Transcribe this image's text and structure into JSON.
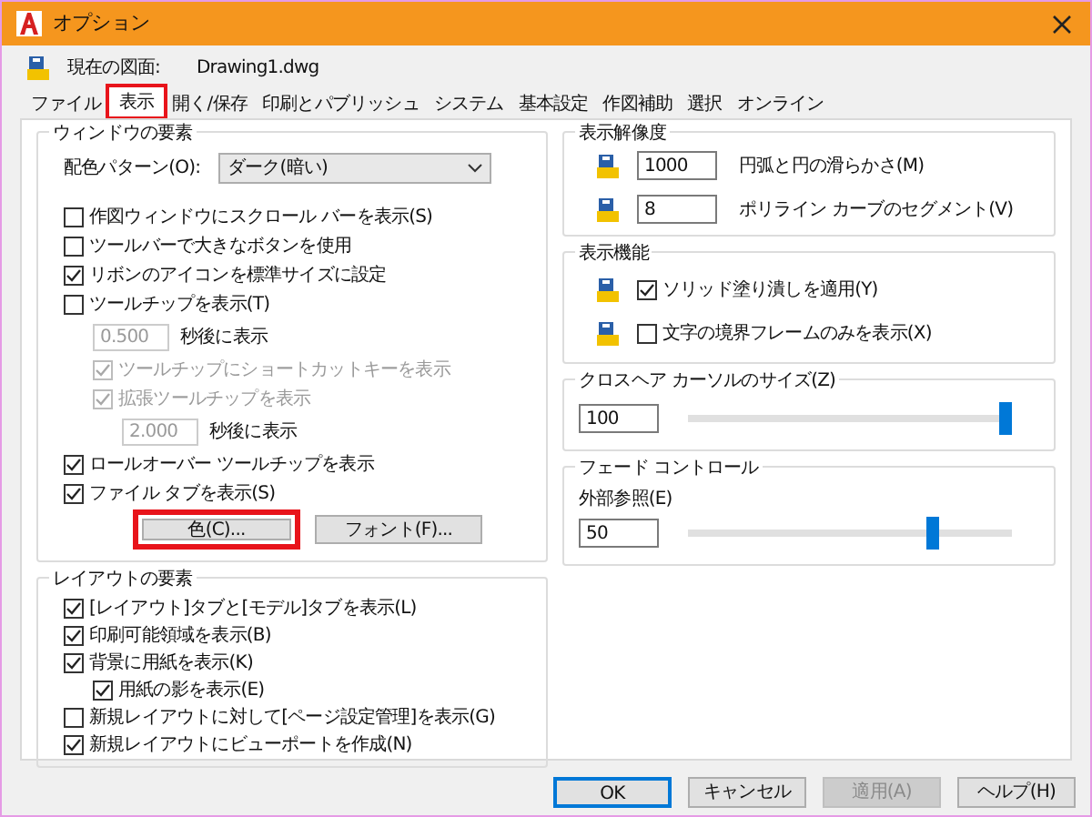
{
  "window": {
    "title": "オプション"
  },
  "drawing": {
    "label": "現在の図面:",
    "name": "Drawing1.dwg"
  },
  "tabs": [
    {
      "label": "ファイル",
      "selected": false,
      "highlighted": false
    },
    {
      "label": "表示",
      "selected": true,
      "highlighted": true
    },
    {
      "label": "開く/保存",
      "selected": false,
      "highlighted": false
    },
    {
      "label": "印刷とパブリッシュ",
      "selected": false,
      "highlighted": false
    },
    {
      "label": "システム",
      "selected": false,
      "highlighted": false
    },
    {
      "label": "基本設定",
      "selected": false,
      "highlighted": false
    },
    {
      "label": "作図補助",
      "selected": false,
      "highlighted": false
    },
    {
      "label": "選択",
      "selected": false,
      "highlighted": false
    },
    {
      "label": "オンライン",
      "selected": false,
      "highlighted": false
    }
  ],
  "window_elements": {
    "title": "ウィンドウの要素",
    "color_scheme": {
      "label": "配色パターン(O):",
      "value": "ダーク(暗い)"
    },
    "items": [
      {
        "kind": "checkbox",
        "label": "作図ウィンドウにスクロール バーを表示(S)",
        "checked": false,
        "disabled": false
      },
      {
        "kind": "checkbox",
        "label": "ツールバーで大きなボタンを使用",
        "checked": false,
        "disabled": false
      },
      {
        "kind": "checkbox",
        "label": "リボンのアイコンを標準サイズに設定",
        "checked": true,
        "disabled": false
      },
      {
        "kind": "checkbox",
        "label": "ツールチップを表示(T)",
        "checked": false,
        "disabled": false,
        "children": [
          {
            "kind": "delay",
            "value": "0.500",
            "label": "秒後に表示",
            "disabled": true
          },
          {
            "kind": "checkbox",
            "label": "ツールチップにショートカットキーを表示",
            "checked": true,
            "disabled": true
          },
          {
            "kind": "checkbox",
            "label": "拡張ツールチップを表示",
            "checked": true,
            "disabled": true,
            "children": [
              {
                "kind": "delay",
                "value": "2.000",
                "label": "秒後に表示",
                "disabled": true
              }
            ]
          }
        ]
      },
      {
        "kind": "checkbox",
        "label": "ロールオーバー ツールチップを表示",
        "checked": true,
        "disabled": false
      },
      {
        "kind": "checkbox",
        "label": "ファイル タブを表示(S)",
        "checked": true,
        "disabled": false
      }
    ],
    "buttons": [
      {
        "label": "色(C)...",
        "highlighted": true
      },
      {
        "label": "フォント(F)...",
        "highlighted": false
      }
    ]
  },
  "layout_elements": {
    "title": "レイアウトの要素",
    "items": [
      {
        "label": "[レイアウト]タブと[モデル]タブを表示(L)",
        "checked": true
      },
      {
        "label": "印刷可能領域を表示(B)",
        "checked": true
      },
      {
        "label": "背景に用紙を表示(K)",
        "checked": true,
        "children": [
          {
            "label": "用紙の影を表示(E)",
            "checked": true
          }
        ]
      },
      {
        "label": "新規レイアウトに対して[ページ設定管理]を表示(G)",
        "checked": false
      },
      {
        "label": "新規レイアウトにビューポートを作成(N)",
        "checked": true
      }
    ]
  },
  "display_resolution": {
    "title": "表示解像度",
    "rows": [
      {
        "value": "1000",
        "label": "円弧と円の滑らかさ(M)"
      },
      {
        "value": "8",
        "label": "ポリライン カーブのセグメント(V)"
      }
    ]
  },
  "display_performance": {
    "title": "表示機能",
    "rows": [
      {
        "label": "ソリッド塗り潰しを適用(Y)",
        "checked": true
      },
      {
        "label": "文字の境界フレームのみを表示(X)",
        "checked": false
      }
    ]
  },
  "crosshair": {
    "title": "クロスヘア カーソルのサイズ(Z)",
    "value": "100",
    "level": 1
  },
  "fade": {
    "title": "フェード コントロール",
    "label": "外部参照(E)",
    "value": "50",
    "level": 0.76
  },
  "footer_buttons": [
    {
      "label": "OK",
      "default": true,
      "disabled": false
    },
    {
      "label": "キャンセル",
      "default": false,
      "disabled": false
    },
    {
      "label": "適用(A)",
      "default": false,
      "disabled": true
    },
    {
      "label": "ヘルプ(H)",
      "default": false,
      "disabled": false
    }
  ]
}
